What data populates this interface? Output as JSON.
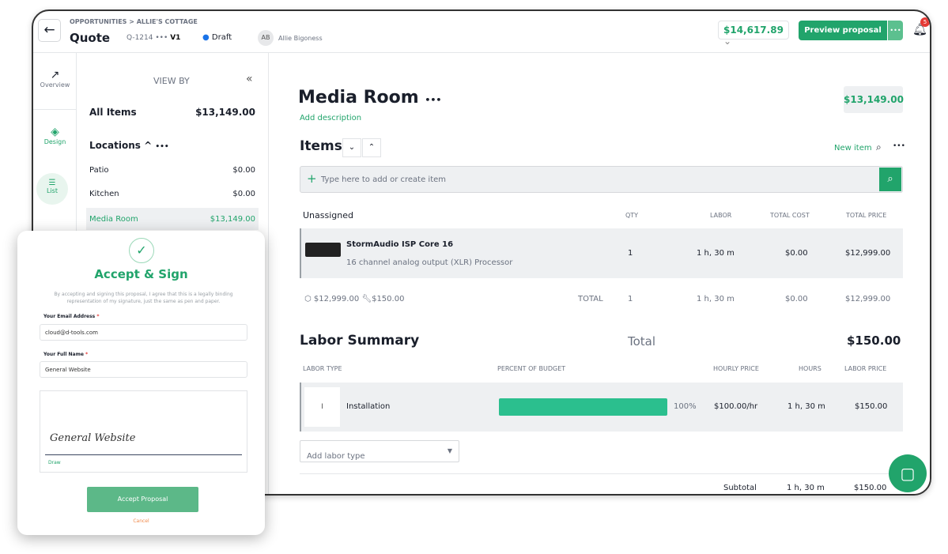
{
  "header": {
    "breadcrumb": "OPPORTUNITIES > ALLIE'S COTTAGE",
    "title": "Quote",
    "quote_id": "Q-1214",
    "more": "•••",
    "version": "V1",
    "status": "Draft",
    "status_color": "#1a73e8",
    "avatar": "AB",
    "user": "Allie Bigoness",
    "total": "$14,617.89",
    "preview_label": "Preview proposal",
    "more_btn": "•••",
    "notifications": "5"
  },
  "nav": [
    {
      "label": "Overview",
      "icon": "trend-icon"
    },
    {
      "label": "Design",
      "icon": "layers-icon"
    },
    {
      "label": "List",
      "icon": "list-icon"
    }
  ],
  "sidebar": {
    "view_by": "VIEW BY",
    "collapse": "«",
    "all_items": "All Items",
    "all_total": "$13,149.00",
    "locations": "Locations",
    "locations_more": "•••",
    "items": [
      {
        "name": "Patio",
        "value": "$0.00"
      },
      {
        "name": "Kitchen",
        "value": "$0.00"
      },
      {
        "name": "Media Room",
        "value": "$13,149.00"
      }
    ]
  },
  "main": {
    "room_title": "Media Room",
    "room_more": "•••",
    "add_description": "Add description",
    "room_total": "$13,149.00",
    "items_title": "Items",
    "new_item": "New item",
    "search_placeholder": "Type here to add or create item",
    "table": {
      "group": "Unassigned",
      "headers": [
        "QTY",
        "LABOR",
        "TOTAL COST",
        "TOTAL PRICE"
      ],
      "rows": [
        {
          "name": "StormAudio ISP Core 16",
          "desc": "16 channel analog output (XLR) Processor",
          "qty": "1",
          "labor": "1 h, 30 m",
          "cost": "$0.00",
          "price": "$12,999.00"
        }
      ],
      "summary": {
        "product": "$12,999.00",
        "labor": "$150.00",
        "label": "TOTAL",
        "qty": "1",
        "labor_time": "1 h, 30 m",
        "cost": "$0.00",
        "price": "$12,999.00"
      }
    },
    "labor": {
      "title": "Labor Summary",
      "total_label": "Total",
      "total": "$150.00",
      "headers": [
        "LABOR TYPE",
        "PERCENT OF BUDGET",
        "HOURLY PRICE",
        "HOURS",
        "LABOR PRICE"
      ],
      "rows": [
        {
          "initial": "I",
          "name": "Installation",
          "percent": 100,
          "percent_label": "100%",
          "hourly": "$100.00/hr",
          "hours": "1 h, 30 m",
          "price": "$150.00"
        }
      ],
      "add_placeholder": "Add labor type",
      "subtotal_label": "Subtotal",
      "subtotal_hours": "1 h, 30 m",
      "subtotal_price": "$150.00"
    }
  },
  "modal": {
    "title": "Accept & Sign",
    "disclaimer": "By accepting and signing this proposal, I agree that this is a legally binding representation of my signature, just the same as pen and paper.",
    "email_label": "Your Email Address",
    "email": "cloud@d-tools.com",
    "name_label": "Your Full Name",
    "name": "General Website",
    "signature": "General Website",
    "draw": "Draw",
    "accept": "Accept Proposal",
    "cancel": "Cancel",
    "required": "*"
  },
  "colors": {
    "accent": "#21a46b",
    "bar": "#2bbf8e"
  }
}
